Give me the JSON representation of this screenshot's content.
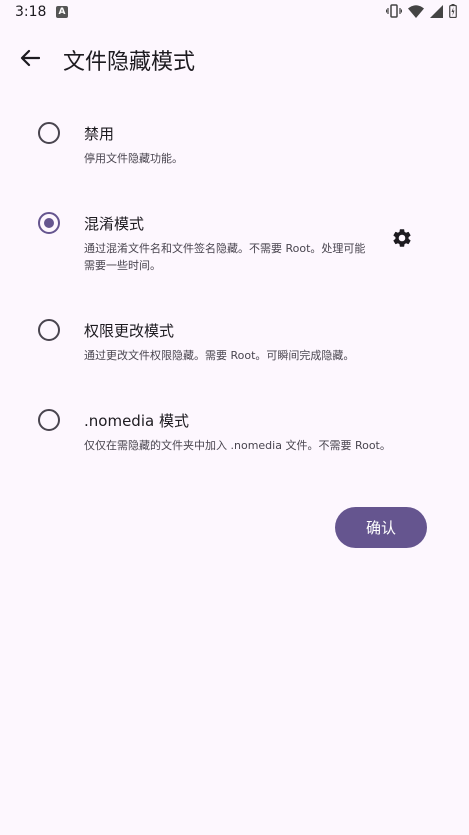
{
  "status_bar": {
    "time": "3:18",
    "notif_letter": "A"
  },
  "app_bar": {
    "title": "文件隐藏模式"
  },
  "options": [
    {
      "title": "禁用",
      "description": "停用文件隐藏功能。",
      "selected": false
    },
    {
      "title": "混淆模式",
      "description": "通过混淆文件名和文件签名隐藏。不需要 Root。处理可能需要一些时间。",
      "selected": true
    },
    {
      "title": "权限更改模式",
      "description": "通过更改文件权限隐藏。需要 Root。可瞬间完成隐藏。",
      "selected": false
    },
    {
      "title": ".nomedia 模式",
      "description": "仅仅在需隐藏的文件夹中加入 .nomedia 文件。不需要 Root。",
      "selected": false
    }
  ],
  "confirm_label": "确认",
  "colors": {
    "accent": "#65558f",
    "background": "#fdf7fe"
  }
}
